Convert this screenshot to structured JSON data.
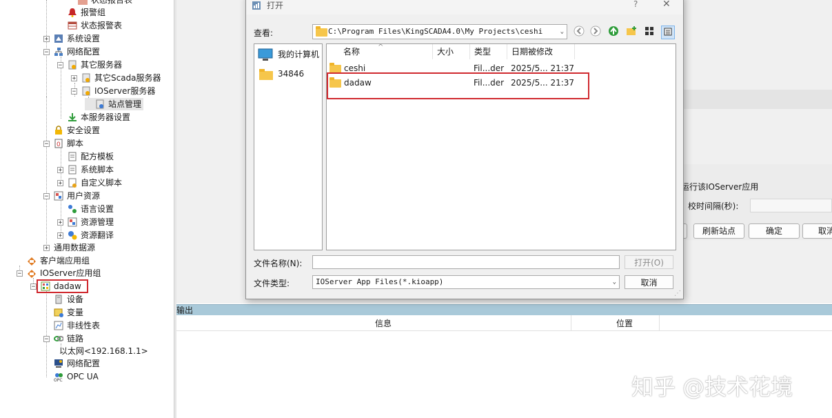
{
  "tree": {
    "items": [
      {
        "label": "状态报告表",
        "indent": 3
      },
      {
        "label": "报警组",
        "indent": 3
      },
      {
        "label": "状态报警表",
        "indent": 3
      },
      {
        "label": "系统设置",
        "indent": 2
      },
      {
        "label": "网络配置",
        "indent": 2
      },
      {
        "label": "其它服务器",
        "indent": 3
      },
      {
        "label": "其它Scada服务器",
        "indent": 4
      },
      {
        "label": "IOServer服务器",
        "indent": 4
      },
      {
        "label": "站点管理",
        "indent": 5
      },
      {
        "label": "本服务器设置",
        "indent": 3
      },
      {
        "label": "安全设置",
        "indent": 2
      },
      {
        "label": "脚本",
        "indent": 2
      },
      {
        "label": "配方模板",
        "indent": 3
      },
      {
        "label": "系统脚本",
        "indent": 3
      },
      {
        "label": "自定义脚本",
        "indent": 3
      },
      {
        "label": "用户资源",
        "indent": 2
      },
      {
        "label": "语言设置",
        "indent": 3
      },
      {
        "label": "资源管理",
        "indent": 3
      },
      {
        "label": "资源翻译",
        "indent": 3
      },
      {
        "label": "通用数据源",
        "indent": 2
      },
      {
        "label": "客户端应用组",
        "indent": 1
      },
      {
        "label": "IOServer应用组",
        "indent": 1
      },
      {
        "label": "dadaw",
        "indent": 2
      },
      {
        "label": "设备",
        "indent": 3
      },
      {
        "label": "变量",
        "indent": 3
      },
      {
        "label": "非线性表",
        "indent": 3
      },
      {
        "label": "链路",
        "indent": 3
      },
      {
        "label": "以太网<192.168.1.1>",
        "indent": 4
      },
      {
        "label": "网络配置",
        "indent": 3
      },
      {
        "label": "OPC UA",
        "indent": 3
      }
    ]
  },
  "right_panel": {
    "checkbox_label": "运行该IOServer应用",
    "interval_label": "校时间隔(秒):",
    "refresh_button": "刷新站点",
    "ok_button": "确定",
    "cancel_button": "取消"
  },
  "output": {
    "title": "输出",
    "col_info": "信息",
    "col_position": "位置"
  },
  "dialog": {
    "title": "打开",
    "help": "?",
    "close": "✕",
    "lookin_label": "查看:",
    "lookin_path": "C:\\Program Files\\KingSCADA4.0\\My Projects\\ceshi",
    "places": [
      {
        "label": "我的计算机"
      },
      {
        "label": "34846"
      }
    ],
    "columns": {
      "name": "名称",
      "size": "大小",
      "type": "类型",
      "modified": "日期被修改"
    },
    "files": [
      {
        "name": "ceshi",
        "size": "",
        "type": "Fil...der",
        "modified": "2025/5... 21:37"
      },
      {
        "name": "dadaw",
        "size": "",
        "type": "Fil...der",
        "modified": "2025/5... 21:37"
      }
    ],
    "filename_label": "文件名称(N):",
    "filename_value": "",
    "filetype_label": "文件类型:",
    "filetype_value": "IOServer App Files(*.kioapp)",
    "open_button": "打开(O)",
    "cancel_button": "取消"
  },
  "watermark": "知乎 @技术花境",
  "colors": {
    "highlight_red": "#d0282e",
    "output_bar": "#a9c9d9",
    "folder": "#f6c64b"
  }
}
